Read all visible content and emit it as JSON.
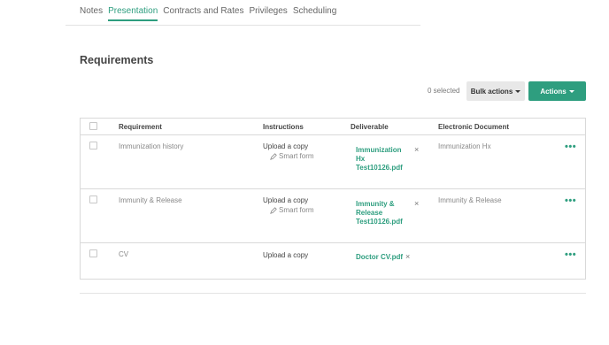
{
  "tabs": [
    {
      "label": "Notes",
      "active": false
    },
    {
      "label": "Presentation",
      "active": true
    },
    {
      "label": "Contracts and Rates",
      "active": false
    },
    {
      "label": "Privileges",
      "active": false
    },
    {
      "label": "Scheduling",
      "active": false
    }
  ],
  "section": {
    "title": "Requirements"
  },
  "toolbar": {
    "selected_text": "0 selected",
    "bulk_actions_label": "Bulk actions",
    "actions_label": "Actions"
  },
  "table": {
    "headers": {
      "requirement": "Requirement",
      "instructions": "Instructions",
      "deliverable": "Deliverable",
      "electronic_document": "Electronic Document"
    },
    "rows": [
      {
        "requirement": "Immunization history",
        "instructions": "Upload a copy",
        "smart_form": "Smart form",
        "deliverable_lines": [
          "Immunization",
          "Hx",
          "Test10126.pdf"
        ],
        "electronic_document": "Immunization Hx",
        "remove_symbol": "×",
        "more_symbol": "•••"
      },
      {
        "requirement": "Immunity & Release",
        "instructions": "Upload a copy",
        "smart_form": "Smart form",
        "deliverable_lines": [
          "Immunity &",
          "Release",
          "Test10126.pdf"
        ],
        "electronic_document": "Immunity & Release",
        "remove_symbol": "×",
        "more_symbol": "•••"
      },
      {
        "requirement": "CV",
        "instructions": "Upload a copy",
        "deliverable_lines": [
          "Doctor CV.pdf"
        ],
        "electronic_document": "",
        "remove_symbol": "×",
        "more_symbol": "•••"
      }
    ]
  },
  "colors": {
    "accent": "#2e9e7f",
    "border": "#d9d9d9"
  },
  "icons": {
    "smart_form": "pencil-icon",
    "remove": "close-icon",
    "more": "more-options-icon",
    "caret": "caret-down-icon"
  }
}
